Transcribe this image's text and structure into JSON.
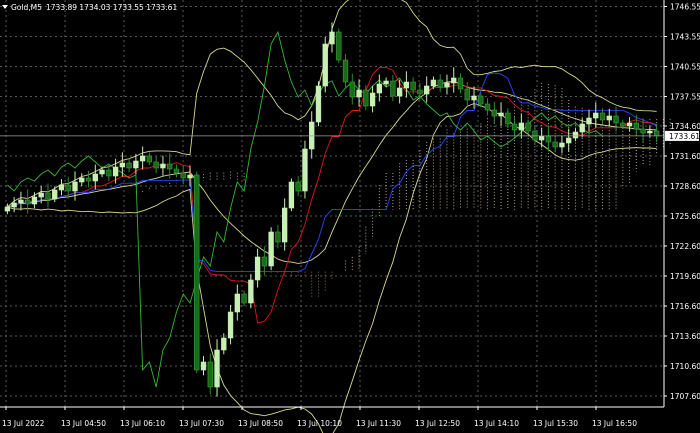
{
  "header": {
    "symbol_timeframe": "Gold,M5",
    "ohlc": "1733.89 1734.03 1733.55 1733.61"
  },
  "price_axis": {
    "ticks": [
      "1746.55",
      "1743.55",
      "1740.55",
      "1737.55",
      "1734.60",
      "1731.60",
      "1728.60",
      "1725.60",
      "1722.60",
      "1719.60",
      "1716.60",
      "1713.60",
      "1710.60",
      "1707.60"
    ],
    "current_price": "1733.61"
  },
  "time_axis": {
    "ticks": [
      "13 Jul 2022",
      "13 Jul 04:50",
      "13 Jul 06:10",
      "13 Jul 07:30",
      "13 Jul 08:50",
      "13 Jul 10:10",
      "13 Jul 11:30",
      "13 Jul 12:50",
      "13 Jul 14:10",
      "13 Jul 15:30",
      "13 Jul 16:50"
    ]
  },
  "colors": {
    "background": "#000000",
    "grid": "#5a5a5a",
    "axis_text": "#ffffff",
    "candle_bull": "#c8f0b4",
    "candle_bear": "#1a6a1a",
    "bollinger": "#d8d890",
    "tenkan": "#e01818",
    "kijun": "#2a46ff",
    "chikou": "#34b834",
    "cloud_bull": "#d8c4a8",
    "cloud_bear": "#b07a5a",
    "price_line": "#a0a0a0"
  },
  "chart_data": {
    "type": "candlestick",
    "instrument": "Gold",
    "timeframe": "M5",
    "ylim": [
      1706.5,
      1747.2
    ],
    "grid": true,
    "candles_close": [
      1726.5,
      1726.9,
      1727.2,
      1726.8,
      1727.5,
      1727.9,
      1727.3,
      1728.2,
      1728.7,
      1728.1,
      1729.0,
      1729.4,
      1729.1,
      1729.8,
      1730.2,
      1729.6,
      1730.5,
      1730.9,
      1730.4,
      1731.1,
      1731.6,
      1731.0,
      1730.4,
      1730.8,
      1730.3,
      1729.9,
      1729.4,
      1729.7,
      1710.2,
      1711.0,
      1708.5,
      1712.2,
      1713.4,
      1716.0,
      1717.8,
      1716.9,
      1719.2,
      1721.5,
      1720.6,
      1724.0,
      1723.0,
      1726.4,
      1729.0,
      1728.1,
      1732.3,
      1735.0,
      1738.6,
      1742.8,
      1744.0,
      1741.2,
      1739.0,
      1737.5,
      1738.2,
      1736.6,
      1737.9,
      1738.8,
      1739.1,
      1737.6,
      1738.4,
      1739.0,
      1738.2,
      1737.8,
      1738.6,
      1739.2,
      1738.5,
      1738.9,
      1739.4,
      1738.3,
      1737.2,
      1737.6,
      1736.8,
      1736.2,
      1735.6,
      1735.9,
      1734.8,
      1734.2,
      1734.9,
      1734.1,
      1733.2,
      1733.6,
      1733.0,
      1732.5,
      1732.9,
      1733.4,
      1734.0,
      1734.8,
      1735.4,
      1735.9,
      1735.2,
      1735.6,
      1734.9,
      1734.6,
      1734.9,
      1734.3,
      1733.9,
      1734.1,
      1733.61
    ]
  }
}
